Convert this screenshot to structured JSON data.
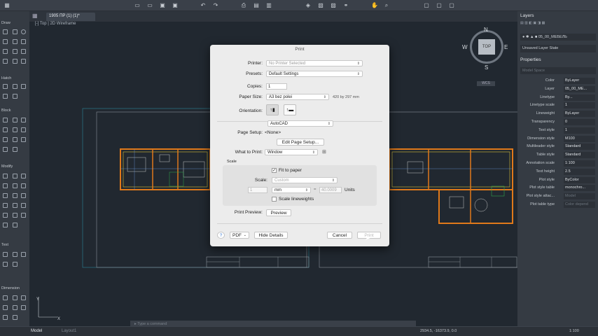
{
  "document_tab": "1905 ПР (1) (1)*",
  "view_label": "[-] Top | 2D Wireframe",
  "left_palette": {
    "sections": [
      "Draw",
      "Hatch",
      "Block",
      "Modify",
      "Text",
      "Dimension"
    ]
  },
  "viewcube": {
    "top": "TOP",
    "n": "N",
    "s": "S",
    "e": "E",
    "w": "W",
    "wcs": "WCS"
  },
  "layers": {
    "title": "Layers",
    "current_layer": "05_00_МЕБЕЛЬ",
    "layer_state": "Unsaved Layer State"
  },
  "properties": {
    "title": "Properties",
    "search_placeholder": "Model Space",
    "rows": [
      {
        "label": "Color",
        "value": "ByLayer"
      },
      {
        "label": "Layer",
        "value": "05_00_МЕ..."
      },
      {
        "label": "Linetype",
        "value": "By..."
      },
      {
        "label": "Linetype scale",
        "value": "1"
      },
      {
        "label": "Lineweight",
        "value": "ByLayer"
      },
      {
        "label": "Transparency",
        "value": "0"
      },
      {
        "label": "Text style",
        "value": "1"
      },
      {
        "label": "Dimension style",
        "value": "M100"
      },
      {
        "label": "Multileader style",
        "value": "Standard"
      },
      {
        "label": "Table style",
        "value": "Standard"
      },
      {
        "label": "Annotation scale",
        "value": "1:100"
      },
      {
        "label": "Text height",
        "value": "2.5"
      },
      {
        "label": "Plot style",
        "value": "ByColor"
      },
      {
        "label": "Plot style table",
        "value": "monochro..."
      },
      {
        "label": "Plot style attac...",
        "value": "Model"
      },
      {
        "label": "Plot table type",
        "value": "Color depend"
      }
    ]
  },
  "command_placeholder": "Type a command",
  "status": {
    "model_tab": "Model",
    "layout_tab": "Layout1",
    "coords": "2934.5, -16373.9, 0.0",
    "scale": "1:100"
  },
  "dialog": {
    "title": "Print",
    "printer_label": "Printer:",
    "printer_value": "No Printer Selected",
    "presets_label": "Presets:",
    "presets_value": "Default Settings",
    "copies_label": "Copies:",
    "copies_value": "1",
    "paper_size_label": "Paper Size:",
    "paper_size_value": "A3 bez polei",
    "paper_dims": "420 by 297 mm",
    "orientation_label": "Orientation:",
    "app_section": "AutoCAD",
    "page_setup_label": "Page Setup:",
    "page_setup_value": "<None>",
    "edit_page_setup": "Edit Page Setup...",
    "what_to_print_label": "What to Print:",
    "what_to_print_value": "Window",
    "scale_section": "Scale",
    "fit_to_paper": "Fit to paper",
    "scale_label": "Scale:",
    "scale_value": "Custom",
    "scale_num": "1",
    "scale_unit": "mm",
    "scale_units_value": "40.0009",
    "units_label": "Units",
    "scale_lineweights": "Scale lineweights",
    "print_preview_label": "Print Preview:",
    "preview_button": "Preview",
    "help": "?",
    "pdf_button": "PDF",
    "hide_details": "Hide Details",
    "cancel": "Cancel",
    "print": "Print"
  }
}
